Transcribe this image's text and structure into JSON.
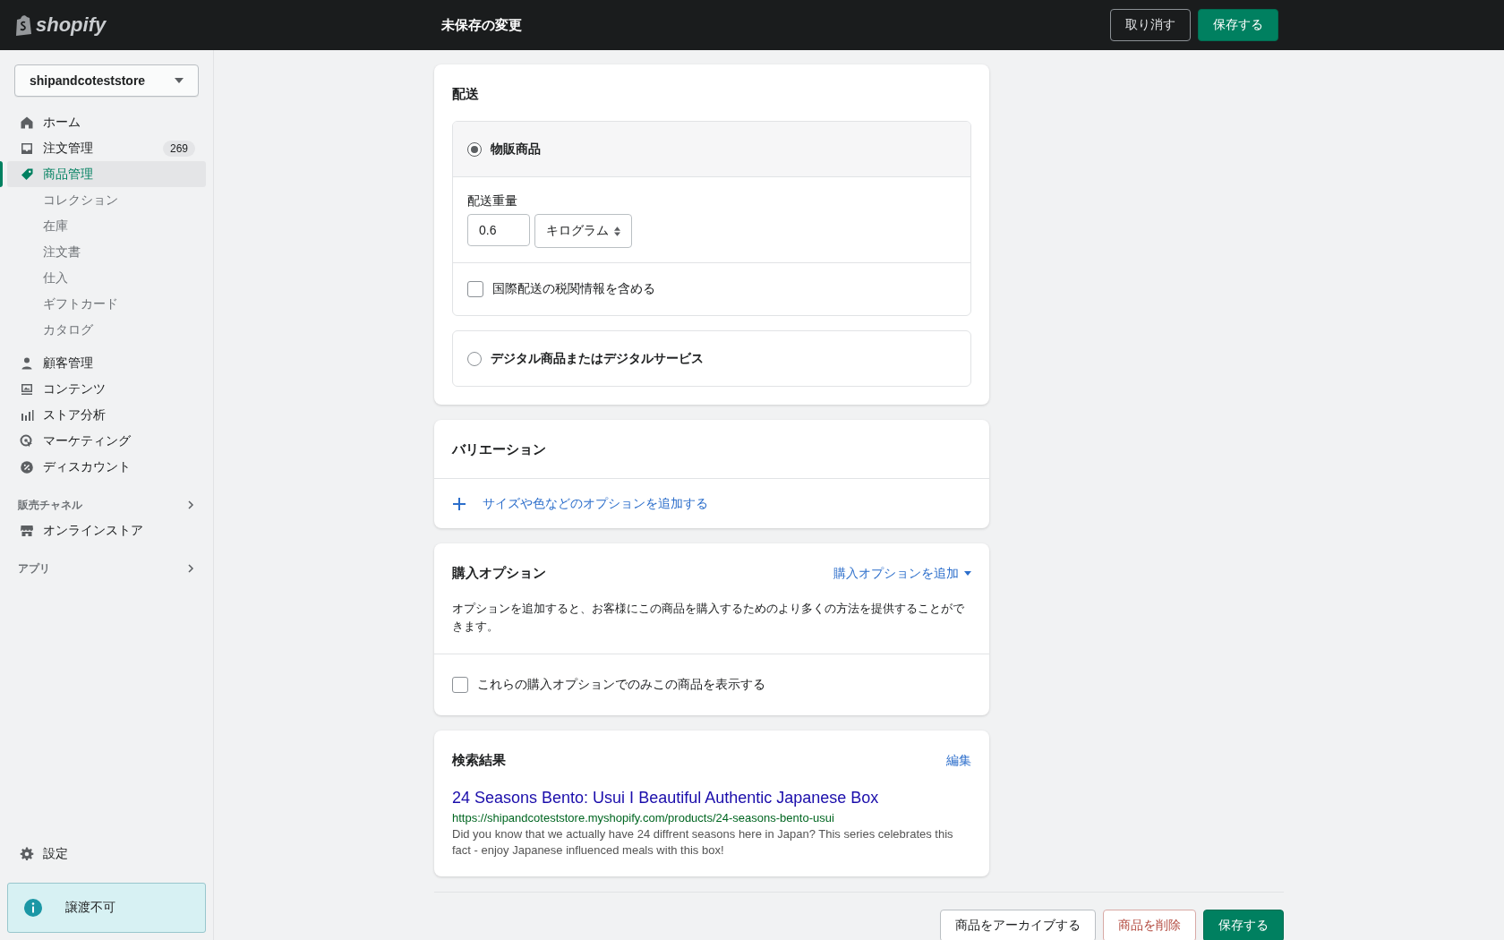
{
  "topbar": {
    "logo": "shopify",
    "title": "未保存の変更",
    "buttons": [
      {
        "label": "取り消す",
        "kind": "secondary"
      },
      {
        "label": "保存する",
        "kind": "primary"
      }
    ]
  },
  "sidebar": {
    "store": "shipandcoteststore",
    "nav": [
      {
        "label": "ホーム",
        "kind": "main",
        "selected": false
      },
      {
        "label": "注文管理",
        "kind": "main",
        "selected": false,
        "badge": "269"
      },
      {
        "label": "商品管理",
        "kind": "main",
        "selected": true
      },
      {
        "label": "コレクション",
        "kind": "sub",
        "selected": false
      },
      {
        "label": "在庫",
        "kind": "sub",
        "selected": false
      },
      {
        "label": "注文書",
        "kind": "sub",
        "selected": false
      },
      {
        "label": "仕入",
        "kind": "sub",
        "selected": false
      },
      {
        "label": "ギフトカード",
        "kind": "sub",
        "selected": false
      },
      {
        "label": "カタログ",
        "kind": "sub",
        "selected": false
      },
      {
        "label": "顧客管理",
        "kind": "main",
        "selected": false
      },
      {
        "label": "コンテンツ",
        "kind": "main",
        "selected": false
      },
      {
        "label": "ストア分析",
        "kind": "main",
        "selected": false
      },
      {
        "label": "マーケティング",
        "kind": "main",
        "selected": false
      },
      {
        "label": "ディスカウント",
        "kind": "main",
        "selected": false
      }
    ],
    "sections": [
      {
        "heading": "販売チャネル",
        "items": [
          {
            "label": "オンラインストア",
            "selected": false
          }
        ]
      },
      {
        "heading": "アプリ"
      }
    ],
    "settings": "設定",
    "notice": "譲渡不可"
  },
  "shipping": {
    "title": "配送",
    "options": [
      {
        "label": "物販商品",
        "selected": true
      },
      {
        "label": "デジタル商品またはデジタルサービス",
        "selected": false
      }
    ],
    "weight_label": "配送重量",
    "weight": "0.6",
    "unit": "キログラム",
    "customs": {
      "label": "国際配送の税関情報を含める",
      "checked": false
    }
  },
  "variants": {
    "title": "バリエーション",
    "add_link": "サイズや色などのオプションを追加する"
  },
  "purchase_options": {
    "title": "購入オプション",
    "add_link": "購入オプションを追加",
    "description": "オプションを追加すると、お客様にこの商品を購入するためのより多くの方法を提供することができます。",
    "only_option": {
      "label": "これらの購入オプションでのみこの商品を表示する",
      "checked": false
    }
  },
  "seo": {
    "title": "検索結果",
    "edit": "編集",
    "page_title": "24 Seasons Bento: Usui I Beautiful Authentic Japanese Box",
    "url": "https://shipandcoteststore.myshopify.com/products/24-seasons-bento-usui",
    "description": "Did you know that we actually have 24 diffrent seasons here in Japan? This series celebrates this fact - enjoy Japanese influenced meals with this box!"
  },
  "footer_buttons": [
    {
      "label": "商品をアーカイブする",
      "kind": "secondary"
    },
    {
      "label": "商品を削除",
      "kind": "destructive"
    },
    {
      "label": "保存する",
      "kind": "primary"
    }
  ]
}
